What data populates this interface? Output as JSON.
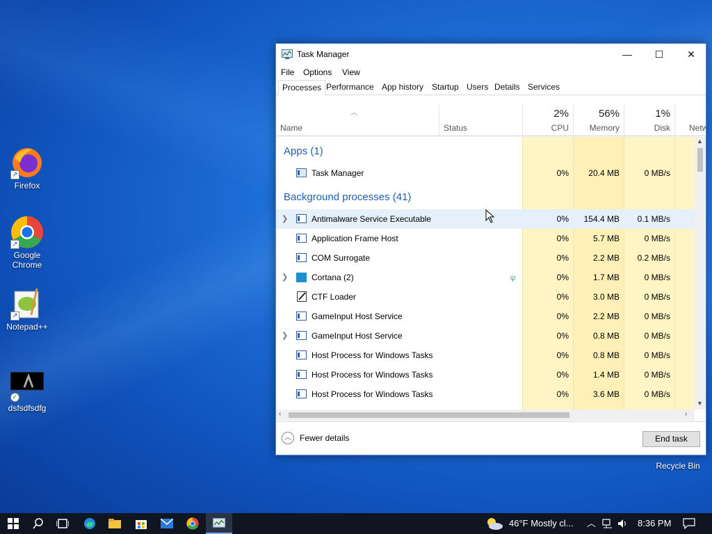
{
  "desktop": {
    "icons": [
      {
        "label": "Firefox"
      },
      {
        "label": "Google Chrome"
      },
      {
        "label": "Notepad++"
      },
      {
        "label": "dsfsdfsdfg"
      },
      {
        "label": "Recycle Bin"
      }
    ]
  },
  "window": {
    "title": "Task Manager",
    "menu": [
      "File",
      "Options",
      "View"
    ],
    "tabs": [
      "Processes",
      "Performance",
      "App history",
      "Startup",
      "Users",
      "Details",
      "Services"
    ],
    "active_tab": "Processes",
    "columns": {
      "name": "Name",
      "status": "Status",
      "cpu": {
        "pct": "2%",
        "label": "CPU"
      },
      "memory": {
        "pct": "56%",
        "label": "Memory"
      },
      "disk": {
        "pct": "1%",
        "label": "Disk"
      },
      "network": {
        "label": "Netw"
      }
    },
    "groups": {
      "apps": "Apps (1)",
      "background": "Background processes (41)"
    },
    "apps": [
      {
        "name": "Task Manager",
        "cpu": "0%",
        "memory": "20.4 MB",
        "disk": "0 MB/s"
      }
    ],
    "processes": [
      {
        "name": "Antimalware Service Executable",
        "cpu": "0%",
        "memory": "154.4 MB",
        "disk": "0.1 MB/s",
        "expandable": true
      },
      {
        "name": "Application Frame Host",
        "cpu": "0%",
        "memory": "5.7 MB",
        "disk": "0 MB/s"
      },
      {
        "name": "COM Surrogate",
        "cpu": "0%",
        "memory": "2.2 MB",
        "disk": "0.2 MB/s"
      },
      {
        "name": "Cortana (2)",
        "cpu": "0%",
        "memory": "1.7 MB",
        "disk": "0 MB/s",
        "expandable": true,
        "status_icon": "leaf-icon"
      },
      {
        "name": "CTF Loader",
        "cpu": "0%",
        "memory": "3.0 MB",
        "disk": "0 MB/s"
      },
      {
        "name": "GameInput Host Service",
        "cpu": "0%",
        "memory": "2.2 MB",
        "disk": "0 MB/s"
      },
      {
        "name": "GameInput Host Service",
        "cpu": "0%",
        "memory": "0.8 MB",
        "disk": "0 MB/s",
        "expandable": true
      },
      {
        "name": "Host Process for Windows Tasks",
        "cpu": "0%",
        "memory": "0.8 MB",
        "disk": "0 MB/s"
      },
      {
        "name": "Host Process for Windows Tasks",
        "cpu": "0%",
        "memory": "1.4 MB",
        "disk": "0 MB/s"
      },
      {
        "name": "Host Process for Windows Tasks",
        "cpu": "0%",
        "memory": "3.6 MB",
        "disk": "0 MB/s"
      }
    ],
    "footer": {
      "fewer_details": "Fewer details",
      "end_task": "End task"
    }
  },
  "taskbar": {
    "weather": "46°F  Mostly cl...",
    "clock": "8:36 PM"
  }
}
